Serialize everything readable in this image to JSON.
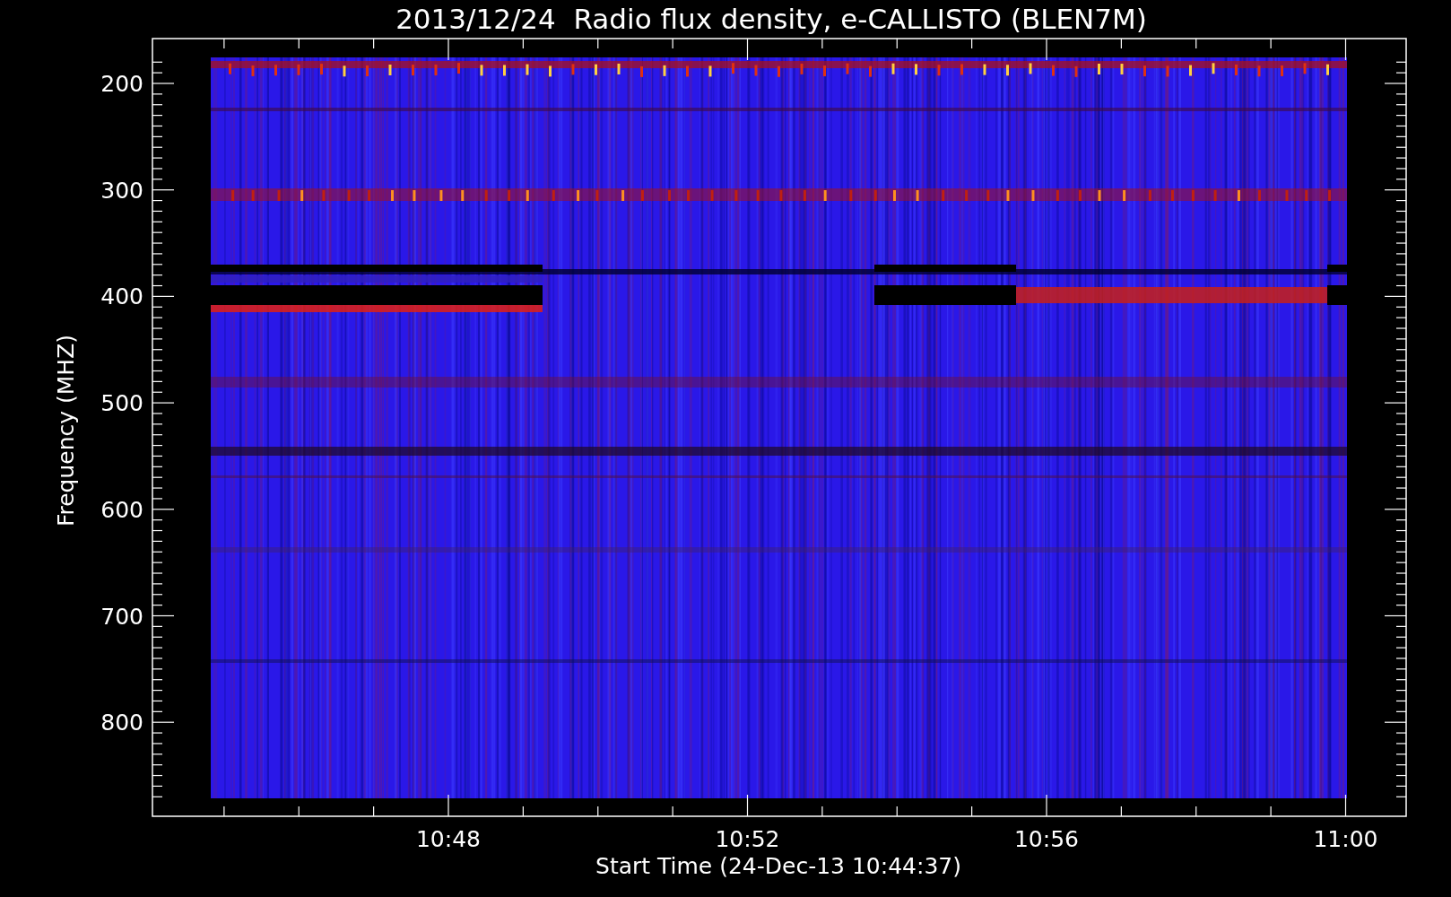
{
  "title": "2013/12/24  Radio flux density, e-CALLISTO (BLEN7M)",
  "y_axis": {
    "label": "Frequency (MHZ)",
    "ticks": [
      "200",
      "300",
      "400",
      "500",
      "600",
      "700",
      "800"
    ]
  },
  "x_axis": {
    "label": "Start Time (24-Dec-13 10:44:37)",
    "ticks": [
      "10:48",
      "10:52",
      "10:56",
      "11:00"
    ]
  }
}
